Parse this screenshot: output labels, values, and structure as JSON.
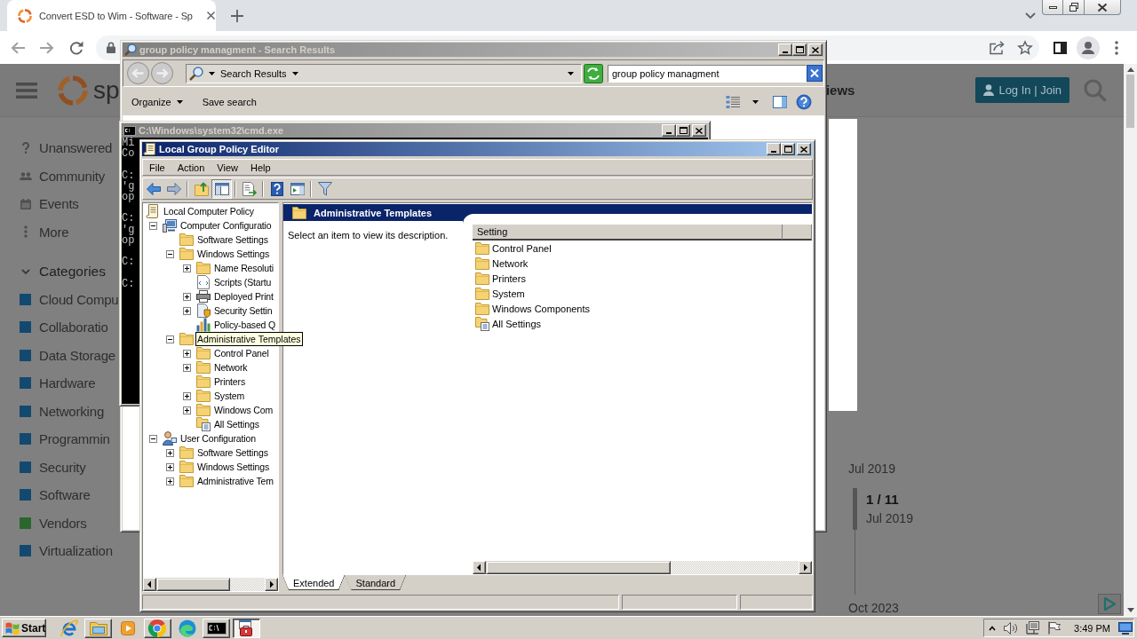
{
  "browser": {
    "tab": {
      "title": "Convert ESD to Wim - Software - Sp"
    },
    "page": {
      "header": {
        "logo_text": "sp",
        "nav_text": "iews",
        "login_button": "Log In | Join"
      },
      "sidebar": {
        "links": [
          {
            "label": "Unanswered",
            "kind": "question"
          },
          {
            "label": "Community",
            "kind": "people"
          },
          {
            "label": "Events",
            "kind": "calendar"
          },
          {
            "label": "More",
            "kind": "dots"
          }
        ],
        "categories": {
          "title": "Categories",
          "expanded": true,
          "items": [
            {
              "label": "Cloud Compu",
              "color": "#14496f"
            },
            {
              "label": "Collaboratio",
              "color": "#14496f"
            },
            {
              "label": "Data Storage",
              "color": "#14496f"
            },
            {
              "label": "Hardware",
              "color": "#14496f"
            },
            {
              "label": "Networking",
              "color": "#14496f"
            },
            {
              "label": "Programmin",
              "color": "#14496f"
            },
            {
              "label": "Security",
              "color": "#14496f"
            },
            {
              "label": "Software",
              "color": "#14496f"
            },
            {
              "label": "Vendors",
              "color": "#2b662e"
            },
            {
              "label": "Virtualization",
              "color": "#14496f"
            }
          ]
        }
      },
      "timeline": {
        "start": "Jul 2019",
        "position": "1 / 11",
        "position_date": "Jul 2019",
        "end": "Oct 2023"
      }
    }
  },
  "explorer": {
    "title": "group policy managment - Search Results",
    "active": false,
    "location": "Search Results",
    "search_value": "group policy managment",
    "toolbar": [
      {
        "label": "Organize",
        "kind": "menu"
      },
      {
        "label": "Save search",
        "kind": "button"
      }
    ]
  },
  "cmd": {
    "title": "C:\\Windows\\system32\\cmd.exe",
    "active": false,
    "output": [
      [
        "Mi",
        "Co"
      ],
      [
        "C:",
        "'g",
        "op"
      ],
      [
        "C:",
        "'g",
        "op"
      ],
      [
        "C:"
      ],
      [
        "C:"
      ]
    ]
  },
  "gpedit": {
    "title": "Local Group Policy Editor",
    "active": true,
    "menu": [
      "File",
      "Action",
      "View",
      "Help"
    ],
    "toolbar": [
      [
        {
          "kind": "back",
          "pressed": false
        },
        {
          "kind": "forward",
          "pressed": false
        }
      ],
      [
        {
          "kind": "up",
          "pressed": false
        },
        {
          "kind": "tree",
          "pressed": true
        }
      ],
      [
        {
          "kind": "export",
          "pressed": false
        }
      ],
      [
        {
          "kind": "help",
          "pressed": false
        },
        {
          "kind": "pane",
          "pressed": false
        }
      ],
      [
        {
          "kind": "filter",
          "pressed": false
        }
      ]
    ],
    "tree": [
      {
        "label": "Local Computer Policy",
        "kind": "policy",
        "children": [
          {
            "label": "Computer Configuratio",
            "kind": "computer",
            "expanded": true,
            "children": [
              {
                "label": "Software Settings",
                "kind": "folder"
              },
              {
                "label": "Windows Settings",
                "kind": "folder",
                "expanded": true,
                "children": [
                  {
                    "label": "Name Resoluti",
                    "kind": "folder",
                    "expanded": false
                  },
                  {
                    "label": "Scripts (Startu",
                    "kind": "script"
                  },
                  {
                    "label": "Deployed Print",
                    "kind": "printer",
                    "expanded": false
                  },
                  {
                    "label": "Security Settin",
                    "kind": "security",
                    "expanded": false
                  },
                  {
                    "label": "Policy-based Q",
                    "kind": "chart"
                  }
                ]
              },
              {
                "label": "Administrative Templates",
                "kind": "folder",
                "expanded": true,
                "hover_tooltip": true,
                "children": [
                  {
                    "label": "Control Panel",
                    "kind": "folder",
                    "expanded": false
                  },
                  {
                    "label": "Network",
                    "kind": "folder",
                    "expanded": false
                  },
                  {
                    "label": "Printers",
                    "kind": "folder"
                  },
                  {
                    "label": "System",
                    "kind": "folder",
                    "expanded": false
                  },
                  {
                    "label": "Windows Com",
                    "kind": "folder",
                    "expanded": false
                  },
                  {
                    "label": "All Settings",
                    "kind": "settings"
                  }
                ]
              }
            ]
          },
          {
            "label": "User Configuration",
            "kind": "user",
            "expanded": true,
            "children": [
              {
                "label": "Software Settings",
                "kind": "folder",
                "expanded": false
              },
              {
                "label": "Windows Settings",
                "kind": "folder",
                "expanded": false
              },
              {
                "label": "Administrative Tem",
                "kind": "folder",
                "expanded": false
              }
            ]
          }
        ]
      }
    ],
    "pane_title": "Administrative Templates",
    "description": "Select an item to view its description.",
    "columns": [
      "Setting"
    ],
    "items": [
      {
        "label": "Control Panel",
        "kind": "folder"
      },
      {
        "label": "Network",
        "kind": "folder"
      },
      {
        "label": "Printers",
        "kind": "folder"
      },
      {
        "label": "System",
        "kind": "folder"
      },
      {
        "label": "Windows Components",
        "kind": "folder"
      },
      {
        "label": "All Settings",
        "kind": "settings"
      }
    ],
    "tabs": [
      {
        "label": "Extended",
        "selected": true
      },
      {
        "label": "Standard",
        "selected": false
      }
    ]
  },
  "taskbar": {
    "start": "Start",
    "apps": [
      {
        "kind": "ie",
        "running": false,
        "selected": false
      },
      {
        "kind": "explorer",
        "running": true,
        "selected": false
      },
      {
        "kind": "media",
        "running": false,
        "selected": false
      },
      {
        "kind": "chrome",
        "running": true,
        "selected": false
      },
      {
        "kind": "edge",
        "running": false,
        "selected": false
      },
      {
        "kind": "cmd",
        "running": true,
        "selected": false
      },
      {
        "kind": "gpedit",
        "running": true,
        "selected": true
      }
    ],
    "clock": "3:49 PM"
  }
}
